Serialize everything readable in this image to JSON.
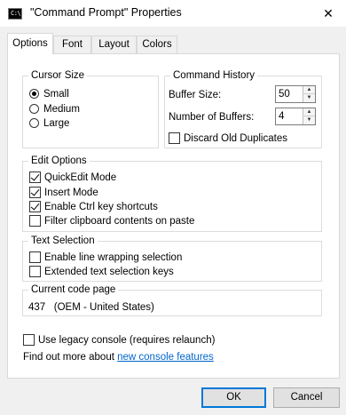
{
  "window": {
    "title": "\"Command Prompt\" Properties",
    "icon_text": "C:\\"
  },
  "tabs": [
    {
      "label": "Options",
      "active": true
    },
    {
      "label": "Font",
      "active": false
    },
    {
      "label": "Layout",
      "active": false
    },
    {
      "label": "Colors",
      "active": false
    }
  ],
  "cursor_size": {
    "title": "Cursor Size",
    "options": [
      {
        "label": "Small",
        "selected": true
      },
      {
        "label": "Medium",
        "selected": false
      },
      {
        "label": "Large",
        "selected": false
      }
    ]
  },
  "command_history": {
    "title": "Command History",
    "buffer_size_label": "Buffer Size:",
    "buffer_size_value": "50",
    "num_buffers_label": "Number of Buffers:",
    "num_buffers_value": "4",
    "discard_label": "Discard Old Duplicates",
    "discard_checked": false
  },
  "edit_options": {
    "title": "Edit Options",
    "items": [
      {
        "label": "QuickEdit Mode",
        "checked": true
      },
      {
        "label": "Insert Mode",
        "checked": true
      },
      {
        "label": "Enable Ctrl key shortcuts",
        "checked": true
      },
      {
        "label": "Filter clipboard contents on paste",
        "checked": false
      }
    ]
  },
  "text_selection": {
    "title": "Text Selection",
    "items": [
      {
        "label": "Enable line wrapping selection",
        "checked": false
      },
      {
        "label": "Extended text selection keys",
        "checked": false
      }
    ]
  },
  "code_page": {
    "title": "Current code page",
    "value": "437   (OEM - United States)"
  },
  "legacy": {
    "label": "Use legacy console (requires relaunch)",
    "checked": false
  },
  "find_out": {
    "text": "Find out more about ",
    "link": "new console features"
  },
  "buttons": {
    "ok": "OK",
    "cancel": "Cancel"
  },
  "colors": {
    "link": "#0066cc",
    "default_button_border": "#0078d7"
  }
}
